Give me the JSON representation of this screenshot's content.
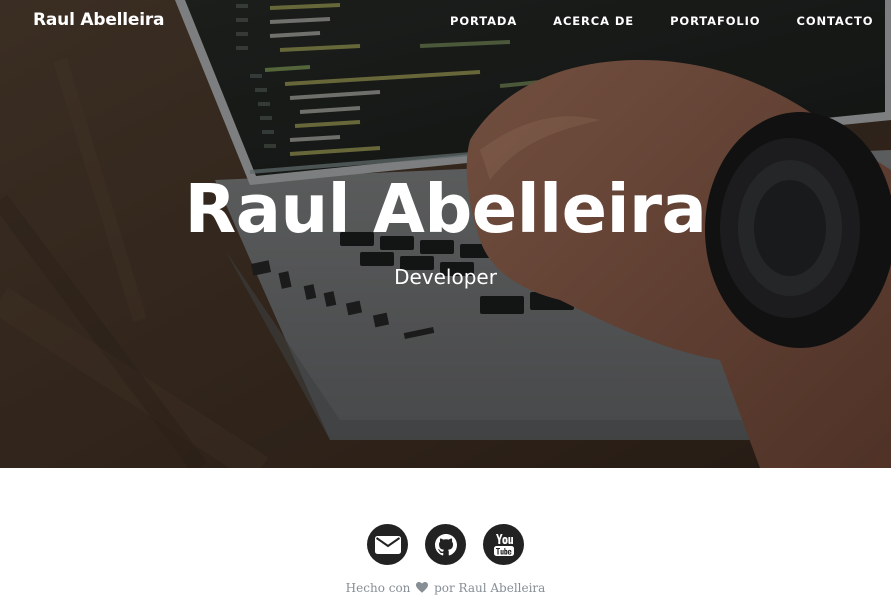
{
  "navbar": {
    "brand": "Raul Abelleira",
    "links": [
      {
        "label": "PORTADA"
      },
      {
        "label": "ACERCA DE"
      },
      {
        "label": "PORTAFOLIO"
      },
      {
        "label": "CONTACTO"
      }
    ]
  },
  "hero": {
    "title": "Raul Abelleira",
    "subtitle": "Developer",
    "background_image": "laptop-code-hands-photo"
  },
  "footer": {
    "social": [
      {
        "icon": "envelope-icon",
        "name": "email"
      },
      {
        "icon": "github-icon",
        "name": "github"
      },
      {
        "icon": "youtube-icon",
        "name": "youtube"
      }
    ],
    "credit_before": "Hecho con",
    "credit_icon": "heart-icon",
    "credit_after": "por Raul Abelleira"
  },
  "colors": {
    "hero_text": "#ffffff",
    "social_bg": "#222222",
    "credit_text": "#868e96"
  }
}
